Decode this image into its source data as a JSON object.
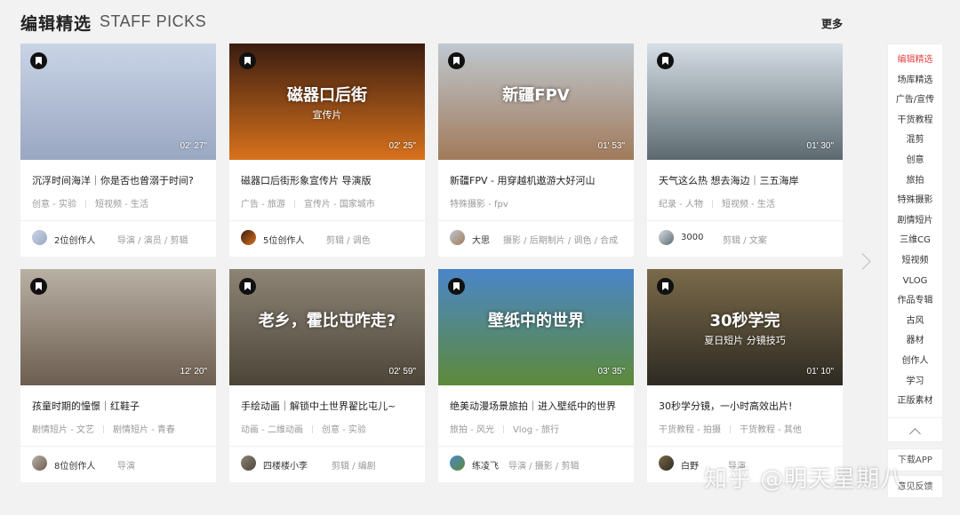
{
  "header": {
    "title_cn": "编辑精选",
    "title_en": "STAFF PICKS",
    "more": "更多"
  },
  "cards": [
    {
      "title": "沉浮时间海洋｜你是否也曾溺于时间?",
      "duration": "02' 27\"",
      "tag1": "创意 - 实验",
      "tag2": "短视频 - 生活",
      "creator": "2位创作人",
      "roles": "导演 / 演员 / 剪辑",
      "thumb_colors": [
        "#c9d4e6",
        "#9aa7c2"
      ]
    },
    {
      "title": "磁器口后街形象宣传片 导演版",
      "duration": "02' 25\"",
      "tag1": "广告 - 旅游",
      "tag2": "宣传片 - 国家城市",
      "creator": "5位创作人",
      "roles": "剪辑 / 调色",
      "thumb_colors": [
        "#3a1c10",
        "#d8721c"
      ],
      "overlay_text": "磁器口后街",
      "overlay_sub": "宣传片"
    },
    {
      "title": "新疆FPV - 用穿越机遨游大好河山",
      "duration": "01' 53\"",
      "tag1": "特殊摄影 - fpv",
      "tag2": "",
      "creator": "大思",
      "roles": "摄影 / 后期制片 / 调色 / 合成",
      "thumb_colors": [
        "#bfc8d0",
        "#a17a5a"
      ],
      "overlay_text": "新疆FPV"
    },
    {
      "title": "天气这么热 想去海边｜三五海岸",
      "duration": "01' 30\"",
      "tag1": "纪录 - 人物",
      "tag2": "短视频 - 生活",
      "creator": "3000",
      "roles": "剪辑 / 文案",
      "thumb_colors": [
        "#d6dee6",
        "#5c6a70"
      ]
    },
    {
      "title": "孩童时期的憧憬｜红鞋子",
      "duration": "12' 20\"",
      "tag1": "剧情短片 - 文艺",
      "tag2": "剧情短片 - 青春",
      "creator": "8位创作人",
      "roles": "导演",
      "thumb_colors": [
        "#b9b0a4",
        "#6c5e50"
      ]
    },
    {
      "title": "手绘动画｜解锁中土世界翟比屯儿~",
      "duration": "02' 59\"",
      "tag1": "动画 - 二维动画",
      "tag2": "创意 - 实验",
      "creator": "四楼楼小李",
      "roles": "剪辑 / 编剧",
      "thumb_colors": [
        "#8d8475",
        "#4c4538"
      ],
      "overlay_text": "老乡，霍比屯咋走?"
    },
    {
      "title": "绝美动漫场景旅拍｜进入壁纸中的世界",
      "duration": "03' 35\"",
      "tag1": "旅拍 - 风光",
      "tag2": "Vlog - 旅行",
      "creator": "练凌飞",
      "roles": "导演 / 摄影 / 剪辑",
      "thumb_colors": [
        "#4a86c8",
        "#5d8a3a"
      ],
      "overlay_text": "壁纸中的世界"
    },
    {
      "title": "30秒学分镜，一小时高效出片!",
      "duration": "01' 10\"",
      "tag1": "干货教程 - 拍摄",
      "tag2": "干货教程 - 其他",
      "creator": "白野",
      "roles": "导演",
      "thumb_colors": [
        "#7a6a4a",
        "#2e2a22"
      ],
      "overlay_text": "30秒学完",
      "overlay_sub": "夏日短片 分镜技巧"
    }
  ],
  "sidebar": {
    "items": [
      {
        "label": "编辑精选"
      },
      {
        "label": "场库精选"
      },
      {
        "label": "广告/宣传"
      },
      {
        "label": "干货教程"
      },
      {
        "label": "混剪"
      },
      {
        "label": "创意"
      },
      {
        "label": "旅拍"
      },
      {
        "label": "特殊摄影"
      },
      {
        "label": "剧情短片"
      },
      {
        "label": "三维CG"
      },
      {
        "label": "短视频"
      },
      {
        "label": "VLOG"
      },
      {
        "label": "作品专辑"
      },
      {
        "label": "古风"
      },
      {
        "label": "器材"
      },
      {
        "label": "创作人"
      },
      {
        "label": "学习"
      },
      {
        "label": "正版素材"
      }
    ],
    "download_app": "下载APP",
    "feedback": "意见反馈"
  },
  "watermark": "知乎 @明天星期八",
  "colors": {
    "accent": "#e64545",
    "background": "#f2f2f2"
  }
}
